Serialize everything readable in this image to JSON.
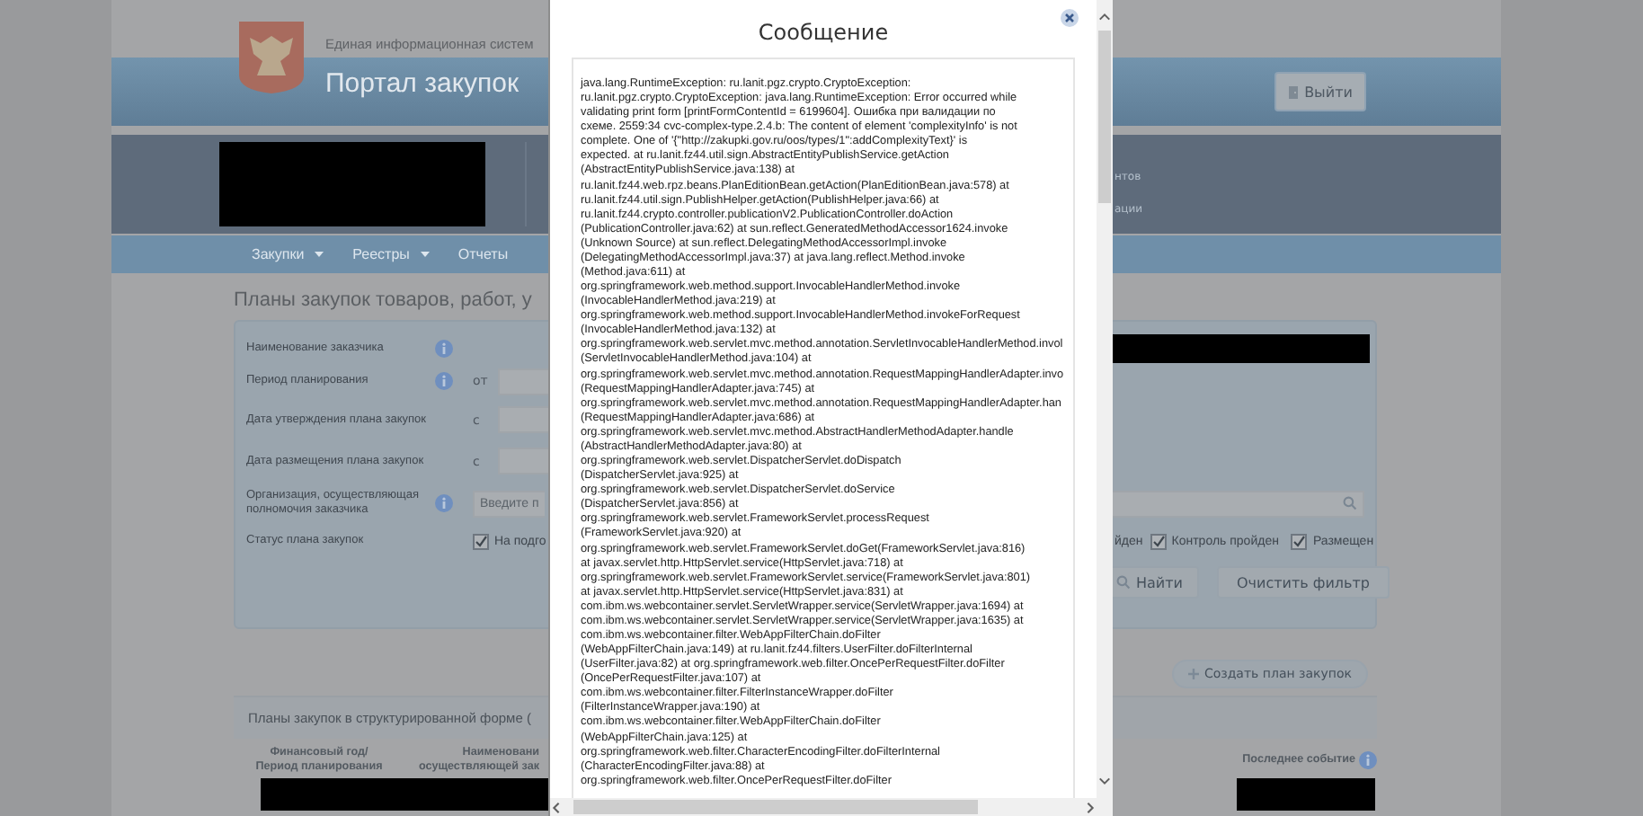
{
  "header": {
    "system_name": "Единая информационная систем",
    "portal_title": "Портал закупок",
    "logout_button": "Выйти",
    "band_fragments": [
      "нтов",
      "ации"
    ]
  },
  "nav": [
    {
      "label": "Закупки",
      "dropdown": true
    },
    {
      "label": "Реестры",
      "dropdown": true
    },
    {
      "label": "Отчеты",
      "dropdown": false
    }
  ],
  "page_title": "Планы закупок товаров, работ, у",
  "filter": {
    "rows": [
      {
        "label": "Наименование заказчика",
        "info": true,
        "kind": "redacted"
      },
      {
        "label": "Период планирования",
        "info": true,
        "kind": "range",
        "prefix": "от"
      },
      {
        "label": "Дата утверждения плана закупок",
        "info": false,
        "kind": "range",
        "prefix": "с"
      },
      {
        "label": "Дата размещения плана закупок",
        "info": false,
        "kind": "range",
        "prefix": "с"
      },
      {
        "label": "Организация, осуществляющая полномочия заказчика",
        "info": true,
        "kind": "search",
        "placeholder": "Введите п"
      },
      {
        "label": "Статус плана закупок",
        "info": false,
        "kind": "status"
      }
    ],
    "status_left": {
      "label": "На подго",
      "checked": true
    },
    "status_fragment": "йден",
    "statuses": [
      {
        "label": "Контроль пройден",
        "checked": true
      },
      {
        "label": "Размещен",
        "checked": true
      }
    ],
    "find_button": "Найти",
    "clear_button": "Очистить фильтр"
  },
  "create_button": "Создать план закупок",
  "section_title": "Планы закупок в структурированной форме (",
  "table": {
    "columns": [
      "Финансовый год/\nПериод планирования",
      "Наименовани\nосуществляющей зак",
      "Последнее событие"
    ]
  },
  "dialog": {
    "title": "Сообщение",
    "lines": [
      "java.lang.RuntimeException: ru.lanit.pgz.crypto.CryptoException:",
      "ru.lanit.pgz.crypto.CryptoException: java.lang.RuntimeException: Error occurred while",
      "validating print form [printFormContentId = 6199604]. Ошибка при валидации по",
      "схеме. 2559:34 cvc-complex-type.2.4.b: The content of element 'complexityInfo' is not",
      "complete. One of '{\"http://zakupki.gov.ru/oos/types/1\":addComplexityText}' is",
      "expected. at ru.lanit.fz44.util.sign.AbstractEntityPublishService.getAction",
      "(AbstractEntityPublishService.java:138) at",
      "ru.lanit.fz44.web.rpz.beans.PlanEditionBean.getAction(PlanEditionBean.java:578) at",
      "ru.lanit.fz44.util.sign.PublishHelper.getAction(PublishHelper.java:66) at",
      "ru.lanit.fz44.crypto.controller.publicationV2.PublicationController.doAction",
      "(PublicationController.java:62) at sun.reflect.GeneratedMethodAccessor1624.invoke",
      "(Unknown Source) at sun.reflect.DelegatingMethodAccessorImpl.invoke",
      "(DelegatingMethodAccessorImpl.java:37) at java.lang.reflect.Method.invoke",
      "(Method.java:611) at",
      "org.springframework.web.method.support.InvocableHandlerMethod.invoke",
      "(InvocableHandlerMethod.java:219) at",
      "org.springframework.web.method.support.InvocableHandlerMethod.invokeForRequest",
      "(InvocableHandlerMethod.java:132) at",
      "org.springframework.web.servlet.mvc.method.annotation.ServletInvocableHandlerMethod.invol",
      "(ServletInvocableHandlerMethod.java:104) at",
      "org.springframework.web.servlet.mvc.method.annotation.RequestMappingHandlerAdapter.invo",
      "(RequestMappingHandlerAdapter.java:745) at",
      "org.springframework.web.servlet.mvc.method.annotation.RequestMappingHandlerAdapter.han",
      "(RequestMappingHandlerAdapter.java:686) at",
      "org.springframework.web.servlet.mvc.method.AbstractHandlerMethodAdapter.handle",
      "(AbstractHandlerMethodAdapter.java:80) at",
      "org.springframework.web.servlet.DispatcherServlet.doDispatch",
      "(DispatcherServlet.java:925) at",
      "org.springframework.web.servlet.DispatcherServlet.doService",
      "(DispatcherServlet.java:856) at",
      "org.springframework.web.servlet.FrameworkServlet.processRequest",
      "(FrameworkServlet.java:920) at",
      "org.springframework.web.servlet.FrameworkServlet.doGet(FrameworkServlet.java:816)",
      "at javax.servlet.http.HttpServlet.service(HttpServlet.java:718) at",
      "org.springframework.web.servlet.FrameworkServlet.service(FrameworkServlet.java:801)",
      "at javax.servlet.http.HttpServlet.service(HttpServlet.java:831) at",
      "com.ibm.ws.webcontainer.servlet.ServletWrapper.service(ServletWrapper.java:1694) at",
      "com.ibm.ws.webcontainer.servlet.ServletWrapper.service(ServletWrapper.java:1635) at",
      "com.ibm.ws.webcontainer.filter.WebAppFilterChain.doFilter",
      "(WebAppFilterChain.java:149) at ru.lanit.fz44.filters.UserFilter.doFilterInternal",
      "(UserFilter.java:82) at org.springframework.web.filter.OncePerRequestFilter.doFilter",
      "(OncePerRequestFilter.java:107) at",
      "com.ibm.ws.webcontainer.filter.FilterInstanceWrapper.doFilter",
      "(FilterInstanceWrapper.java:190) at",
      "com.ibm.ws.webcontainer.filter.WebAppFilterChain.doFilter",
      "(WebAppFilterChain.java:125) at",
      "org.springframework.web.filter.CharacterEncodingFilter.doFilterInternal",
      "(CharacterEncodingFilter.java:88) at",
      "org.springframework.web.filter.OncePerRequestFilter.doFilter"
    ]
  }
}
